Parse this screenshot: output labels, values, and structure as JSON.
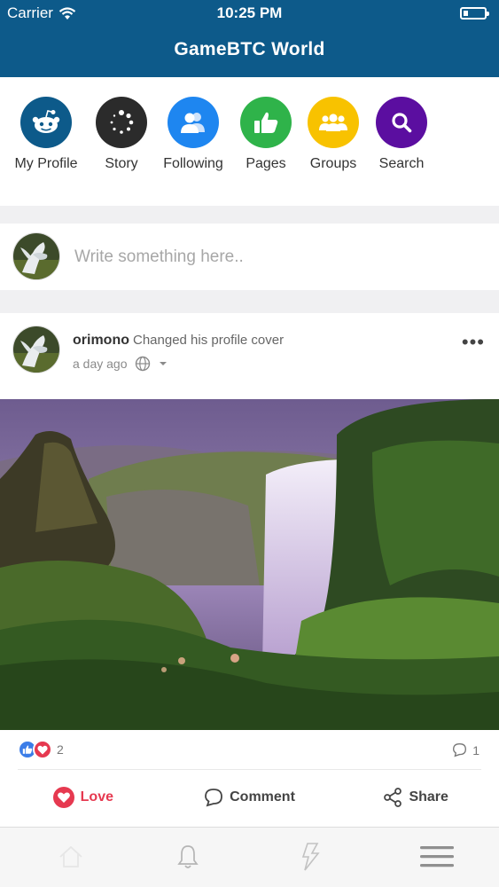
{
  "status_bar": {
    "carrier": "Carrier",
    "time": "10:25 PM"
  },
  "header": {
    "title": "GameBTC World"
  },
  "shortcuts": [
    {
      "label": "My Profile",
      "icon": "reddit-alien-icon",
      "color": "#0d5a8a"
    },
    {
      "label": "Story",
      "icon": "loading-dots-icon",
      "color": "#2b2b2b"
    },
    {
      "label": "Following",
      "icon": "users-icon",
      "color": "#1e86f0"
    },
    {
      "label": "Pages",
      "icon": "thumbs-up-icon",
      "color": "#2fb34a"
    },
    {
      "label": "Groups",
      "icon": "group-icon",
      "color": "#f8c200"
    },
    {
      "label": "Search",
      "icon": "search-icon",
      "color": "#5b0ea0"
    }
  ],
  "composer": {
    "placeholder": "Write something here.."
  },
  "post": {
    "author": "orimono",
    "action": "Changed his profile cover",
    "time": "a day ago",
    "privacy_icon": "globe-icon",
    "reaction_count": "2",
    "comment_count": "1",
    "actions": {
      "love": "Love",
      "comment": "Comment",
      "share": "Share"
    }
  },
  "colors": {
    "header": "#0d5a8a",
    "love": "#e63950",
    "like_blue": "#3b7de8"
  },
  "tabbar": {
    "items": [
      "home-icon",
      "bell-icon",
      "lightning-icon",
      "menu-icon"
    ]
  }
}
